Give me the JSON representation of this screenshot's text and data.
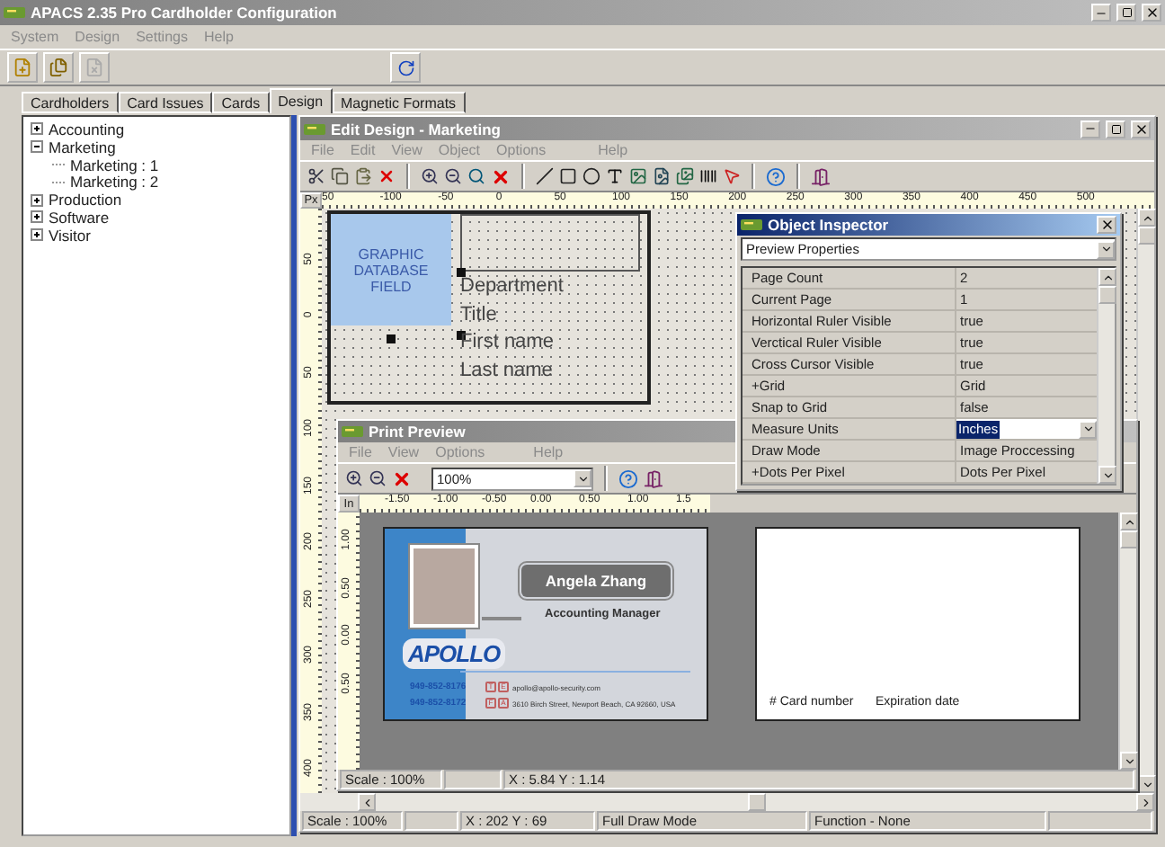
{
  "window": {
    "title": "APACS 2.35 Pro Cardholder Configuration"
  },
  "menu": [
    "System",
    "Design",
    "Settings",
    "Help"
  ],
  "tabs": [
    {
      "label": "Cardholders",
      "selected": false
    },
    {
      "label": "Card Issues",
      "selected": false
    },
    {
      "label": "Cards",
      "selected": false
    },
    {
      "label": "Design",
      "selected": true
    },
    {
      "label": "Magnetic Formats",
      "selected": false
    }
  ],
  "tree": [
    {
      "label": "Accounting",
      "expanded": false
    },
    {
      "label": "Marketing",
      "expanded": true,
      "children": [
        {
          "label": "Marketing : 1"
        },
        {
          "label": "Marketing : 2"
        }
      ]
    },
    {
      "label": "Production",
      "expanded": false
    },
    {
      "label": "Software",
      "expanded": false
    },
    {
      "label": "Visitor",
      "expanded": false
    }
  ],
  "edit_design": {
    "title": "Edit Design - Marketing",
    "menu": [
      "File",
      "Edit",
      "View",
      "Object",
      "Options",
      "Help"
    ],
    "ruler": {
      "unit": "Px",
      "labels": [
        "50",
        "-100",
        "-50",
        "0",
        "50",
        "100",
        "150",
        "200",
        "250",
        "300",
        "350",
        "400",
        "450",
        "500"
      ]
    },
    "vertical_ruler": [
      "50",
      "0",
      "50",
      "100",
      "150",
      "200",
      "250",
      "300",
      "350",
      "400"
    ],
    "graphic_field": "GRAPHIC DATABASE FIELD",
    "fields": [
      "Department",
      "Title",
      "First name",
      "Last name"
    ],
    "status_bar": {
      "scale": "Scale : 100%",
      "position": "X : 202 Y : 69",
      "mode": "Full Draw Mode",
      "function": "Function - None"
    }
  },
  "object_inspector": {
    "title": "Object Inspector",
    "selector": "Preview Properties",
    "rows": [
      {
        "name": "Page Count",
        "value": "2",
        "kind": "text"
      },
      {
        "name": "Current Page",
        "value": "1",
        "kind": "text"
      },
      {
        "name": "Horizontal Ruler Visible",
        "value": "true",
        "kind": "text"
      },
      {
        "name": "Verctical Ruler Visible",
        "value": "true",
        "kind": "text"
      },
      {
        "name": "Cross Cursor Visible",
        "value": "true",
        "kind": "text"
      },
      {
        "name": "+Grid",
        "value": "Grid",
        "kind": "text"
      },
      {
        "name": "Snap to Grid",
        "value": "false",
        "kind": "text"
      },
      {
        "name": "Measure Units",
        "value": "Inches",
        "kind": "dropdown"
      },
      {
        "name": "Draw Mode",
        "value": "Image Proccessing",
        "kind": "text"
      },
      {
        "name": "+Dots Per Pixel",
        "value": "Dots Per Pixel",
        "kind": "text"
      }
    ]
  },
  "print_preview": {
    "title": "Print Preview",
    "menu": [
      "File",
      "View",
      "Options",
      "Help"
    ],
    "zoom": "100%",
    "ruler": {
      "unit": "In",
      "labels": [
        "-1.50",
        "-1.00",
        "-0.50",
        "0.00",
        "0.50",
        "1.00",
        "1.5"
      ]
    },
    "vertical_ruler": [
      "1.00",
      "0.50",
      "0.00",
      "0.50"
    ],
    "card_front": {
      "name": "Angela Zhang",
      "job_title": "Accounting Manager",
      "logo": "APOLLO",
      "phones": [
        "949-852-8176",
        "949-852-8172"
      ],
      "contact_letters": [
        "T",
        "E",
        "F",
        "A"
      ],
      "email": "apollo@apollo-security.com",
      "address": "3610 Birch Street, Newport Beach, CA 92660, USA"
    },
    "card_back": {
      "number": "# Card number",
      "expiry": "Expiration date"
    },
    "status_bar": {
      "scale": "Scale : 100%",
      "position": "X : 5.84 Y : 1.14"
    }
  }
}
